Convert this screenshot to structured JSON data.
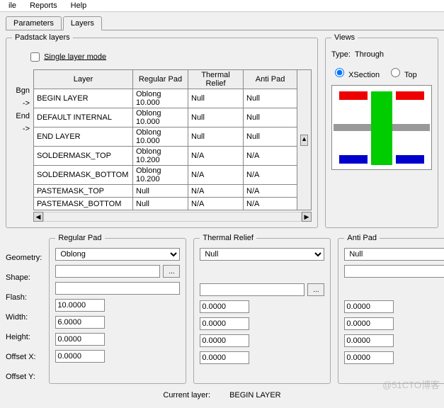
{
  "menu": [
    "ile",
    "Reports",
    "Help"
  ],
  "tabs": [
    {
      "label": "Parameters",
      "active": false
    },
    {
      "label": "Layers",
      "active": true
    }
  ],
  "padstack": {
    "legend": "Padstack layers",
    "single_layer_mode": "Single layer mode",
    "headers": [
      "Layer",
      "Regular Pad",
      "Thermal Relief",
      "Anti Pad"
    ],
    "rowlabels": [
      "Bgn",
      "->",
      "End",
      "->",
      "",
      "",
      ""
    ],
    "rows": [
      [
        "BEGIN LAYER",
        "Oblong 10.000",
        "Null",
        "Null"
      ],
      [
        "DEFAULT INTERNAL",
        "Oblong 10.000",
        "Null",
        "Null"
      ],
      [
        "END LAYER",
        "Oblong 10.000",
        "Null",
        "Null"
      ],
      [
        "SOLDERMASK_TOP",
        "Oblong 10.200",
        "N/A",
        "N/A"
      ],
      [
        "SOLDERMASK_BOTTOM",
        "Oblong 10.200",
        "N/A",
        "N/A"
      ],
      [
        "PASTEMASK_TOP",
        "Null",
        "N/A",
        "N/A"
      ],
      [
        "PASTEMASK_BOTTOM",
        "Null",
        "N/A",
        "N/A"
      ]
    ]
  },
  "views": {
    "legend": "Views",
    "type_label": "Type:",
    "type_value": "Through",
    "xsection": "XSection",
    "top": "Top"
  },
  "props": {
    "labels": [
      "Geometry:",
      "Shape:",
      "Flash:",
      "Width:",
      "Height:",
      "Offset X:",
      "Offset Y:"
    ],
    "regular": {
      "legend": "Regular Pad",
      "geometry": "Oblong",
      "shape": "",
      "flash": "",
      "width": "10.0000",
      "height": "6.0000",
      "ox": "0.0000",
      "oy": "0.0000"
    },
    "thermal": {
      "legend": "Thermal Relief",
      "geometry": "Null",
      "shape": "",
      "flash": "",
      "width": "0.0000",
      "height": "0.0000",
      "ox": "0.0000",
      "oy": "0.0000"
    },
    "anti": {
      "legend": "Anti Pad",
      "geometry": "Null",
      "shape": "",
      "flash": "",
      "width": "0.0000",
      "height": "0.0000",
      "ox": "0.0000",
      "oy": "0.0000"
    }
  },
  "current_layer_label": "Current layer:",
  "current_layer_value": "BEGIN LAYER",
  "watermark": "@51CTO博客"
}
